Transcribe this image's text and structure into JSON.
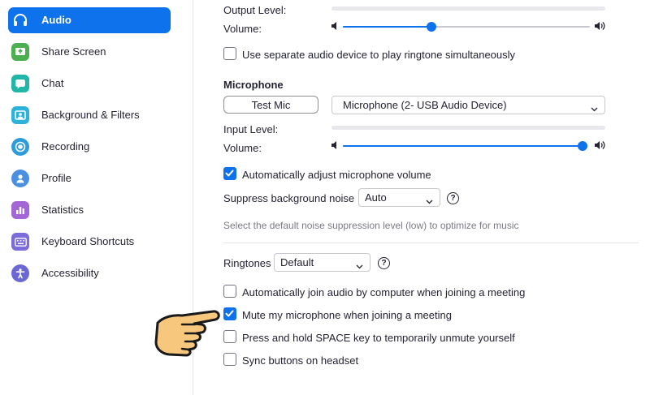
{
  "sidebar": {
    "items": [
      {
        "label": "Audio",
        "icon": "headphones-icon",
        "active": true
      },
      {
        "label": "Share Screen",
        "icon": "share-screen-icon",
        "color": "#4caf50"
      },
      {
        "label": "Chat",
        "icon": "chat-icon",
        "color": "#21b6a8"
      },
      {
        "label": "Background & Filters",
        "icon": "background-icon",
        "color": "#2db3d9"
      },
      {
        "label": "Recording",
        "icon": "recording-icon",
        "color": "#2d9cdb"
      },
      {
        "label": "Profile",
        "icon": "profile-icon",
        "color": "#4a90e2"
      },
      {
        "label": "Statistics",
        "icon": "statistics-icon",
        "color": "#a366d6"
      },
      {
        "label": "Keyboard Shortcuts",
        "icon": "keyboard-icon",
        "color": "#7b6cd9"
      },
      {
        "label": "Accessibility",
        "icon": "accessibility-icon",
        "color": "#6b68d6"
      }
    ]
  },
  "speaker": {
    "output_level_label": "Output Level:",
    "volume_label": "Volume:",
    "volume_value": 0.36,
    "separate_ringtone_label": "Use separate audio device to play ringtone simultaneously",
    "separate_ringtone_checked": false
  },
  "microphone": {
    "section_title": "Microphone",
    "test_button": "Test Mic",
    "device": "Microphone (2- USB Audio Device)",
    "input_level_label": "Input Level:",
    "volume_label": "Volume:",
    "volume_value": 1.0,
    "auto_adjust_label": "Automatically adjust microphone volume",
    "auto_adjust_checked": true,
    "suppress_label": "Suppress background noise",
    "suppress_value": "Auto",
    "suppress_hint": "Select the default noise suppression level (low) to optimize for music"
  },
  "ringtones": {
    "label": "Ringtones",
    "value": "Default"
  },
  "options": [
    {
      "label": "Automatically join audio by computer when joining a meeting",
      "checked": false
    },
    {
      "label": "Mute my microphone when joining a meeting",
      "checked": true
    },
    {
      "label": "Press and hold SPACE key to temporarily unmute yourself",
      "checked": false
    },
    {
      "label": "Sync buttons on headset",
      "checked": false
    }
  ],
  "help_glyph": "?",
  "accent_color": "#0e72ed",
  "pointer_icon": "pointing-hand-icon"
}
